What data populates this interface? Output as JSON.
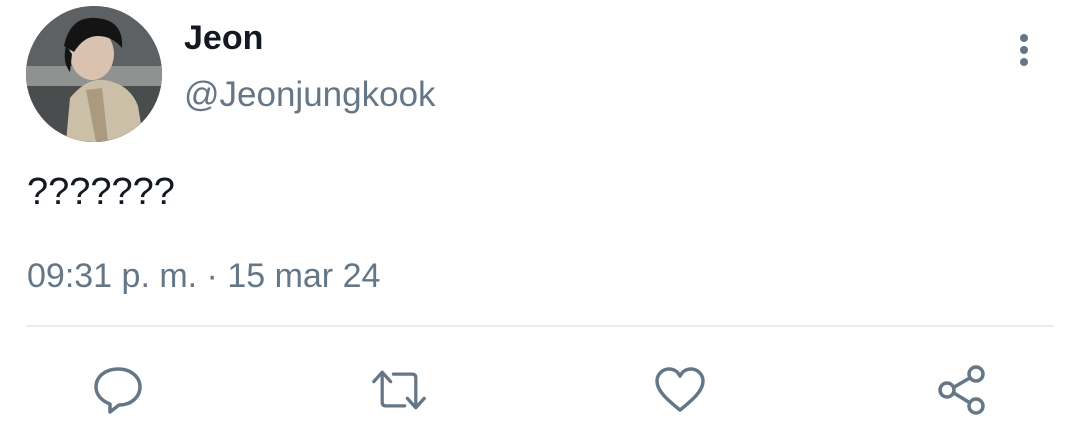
{
  "user": {
    "display_name": "Jeon",
    "handle": "@Jeonjungkook",
    "avatar_icon": "profile-photo"
  },
  "tweet": {
    "text": "???????",
    "timestamp": "09:31 p. m. · 15 mar 24"
  },
  "actions": {
    "reply_icon": "comment-bubble-icon",
    "retweet_icon": "retweet-arrows-icon",
    "like_icon": "heart-icon",
    "share_icon": "share-nodes-icon"
  },
  "colors": {
    "name_text": "#141823",
    "secondary_text": "#657786",
    "divider": "#e6ecf0",
    "background": "#ffffff"
  }
}
